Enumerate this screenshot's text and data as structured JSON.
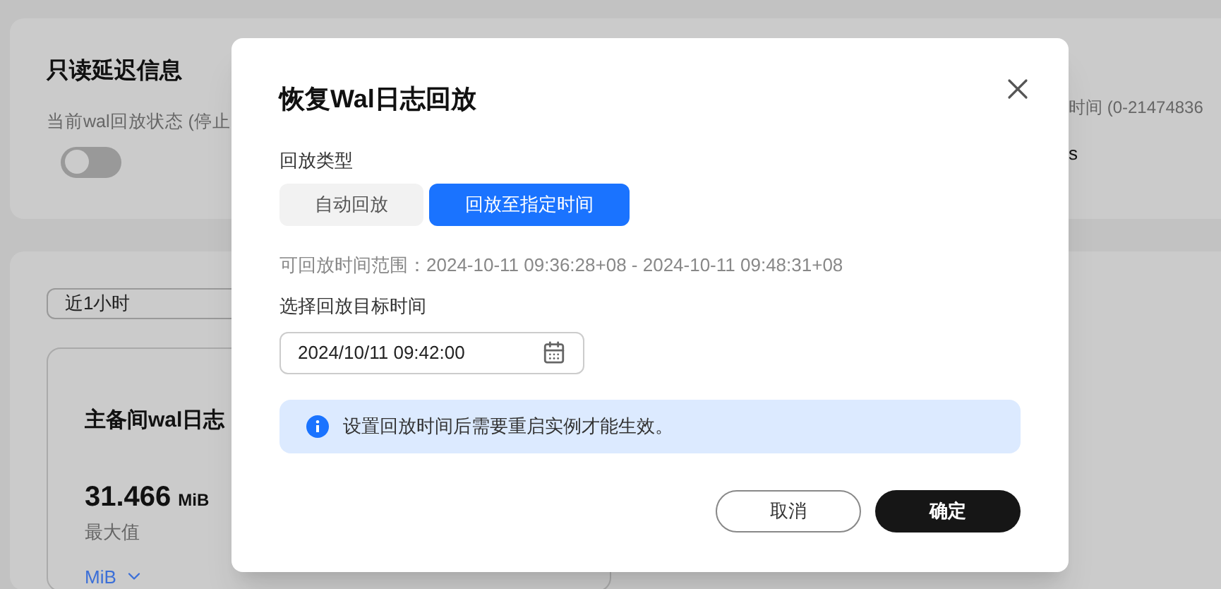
{
  "background": {
    "section_title": "只读延迟信息",
    "replay_status_label": "当前wal回放状态 (停止",
    "replay_switch": {
      "on": false
    },
    "delay_label": "时间 (0-21474836",
    "delay_value": "s",
    "time_range_select": {
      "value": "近1小时"
    },
    "metric_card": {
      "title": "主备间wal日志",
      "value": "31.466",
      "unit": "MiB",
      "caption": "最大值",
      "unit_select": "MiB"
    }
  },
  "dialog": {
    "title": "恢复Wal日志回放",
    "replay_type_label": "回放类型",
    "replay_types": [
      {
        "label": "自动回放",
        "selected": false
      },
      {
        "label": "回放至指定时间",
        "selected": true
      }
    ],
    "range_text": "可回放时间范围：2024-10-11 09:36:28+08 - 2024-10-11 09:48:31+08",
    "target_label": "选择回放目标时间",
    "target_time": "2024/10/11 09:42:00",
    "notice": "设置回放时间后需要重启实例才能生效。",
    "buttons": [
      {
        "label": "取消",
        "kind": "secondary"
      },
      {
        "label": "确定",
        "kind": "primary"
      }
    ]
  }
}
